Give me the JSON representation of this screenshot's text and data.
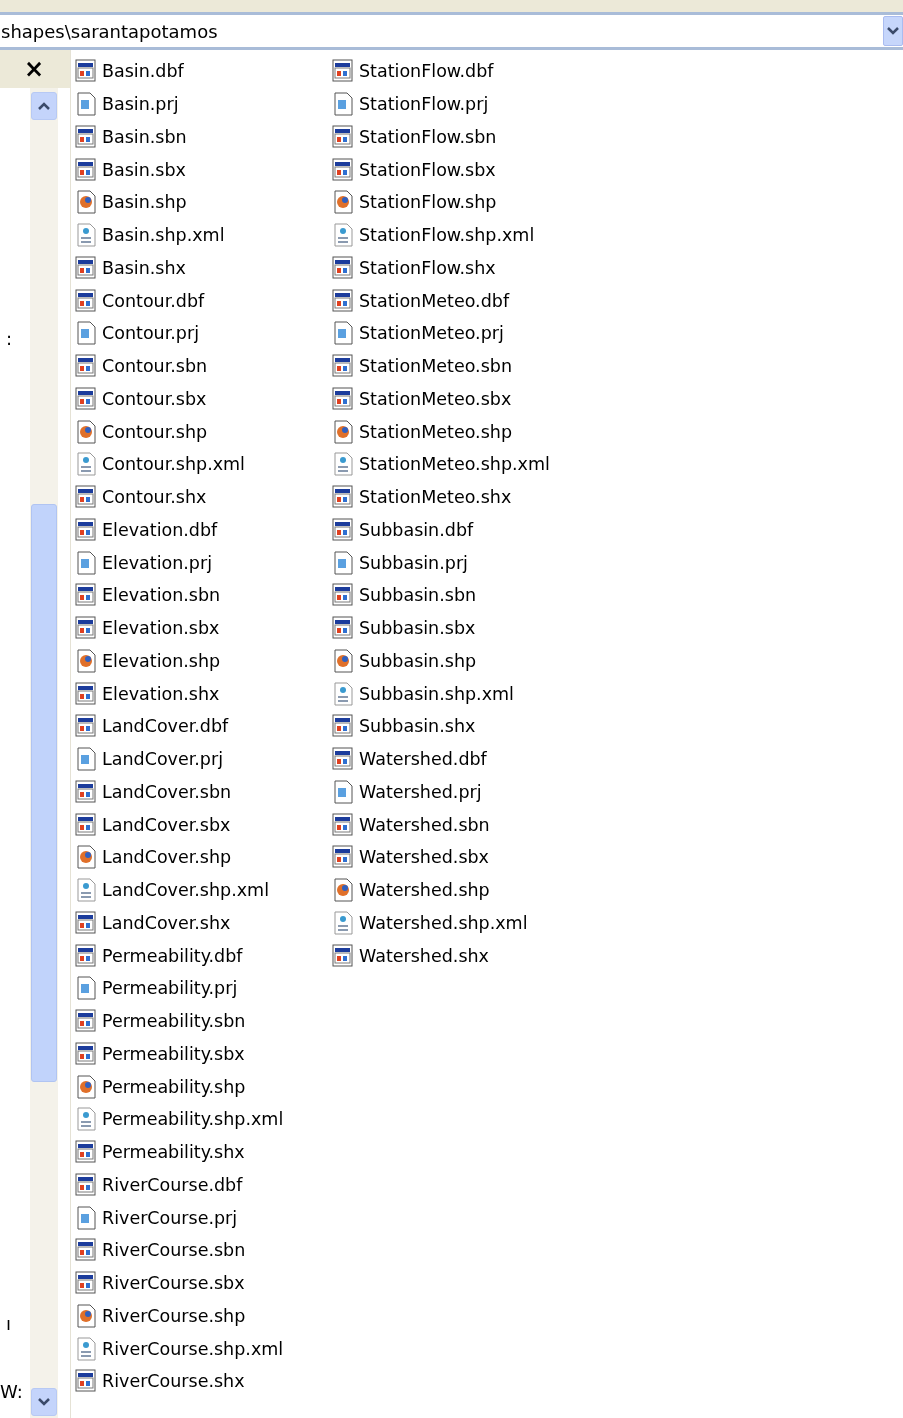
{
  "address_bar": {
    "path": "shapes\\sarantapotamos"
  },
  "left_pane": {
    "close": "×",
    "fragments": [
      ":",
      "ı",
      "W:"
    ]
  },
  "files": [
    {
      "name": "Basin.dbf",
      "kind": "table"
    },
    {
      "name": "Basin.prj",
      "kind": "projection"
    },
    {
      "name": "Basin.sbn",
      "kind": "table"
    },
    {
      "name": "Basin.sbx",
      "kind": "table"
    },
    {
      "name": "Basin.shp",
      "kind": "shape"
    },
    {
      "name": "Basin.shp.xml",
      "kind": "xml"
    },
    {
      "name": "Basin.shx",
      "kind": "table"
    },
    {
      "name": "Contour.dbf",
      "kind": "table"
    },
    {
      "name": "Contour.prj",
      "kind": "projection"
    },
    {
      "name": "Contour.sbn",
      "kind": "table"
    },
    {
      "name": "Contour.sbx",
      "kind": "table"
    },
    {
      "name": "Contour.shp",
      "kind": "shape"
    },
    {
      "name": "Contour.shp.xml",
      "kind": "xml"
    },
    {
      "name": "Contour.shx",
      "kind": "table"
    },
    {
      "name": "Elevation.dbf",
      "kind": "table"
    },
    {
      "name": "Elevation.prj",
      "kind": "projection"
    },
    {
      "name": "Elevation.sbn",
      "kind": "table"
    },
    {
      "name": "Elevation.sbx",
      "kind": "table"
    },
    {
      "name": "Elevation.shp",
      "kind": "shape"
    },
    {
      "name": "Elevation.shx",
      "kind": "table"
    },
    {
      "name": "LandCover.dbf",
      "kind": "table"
    },
    {
      "name": "LandCover.prj",
      "kind": "projection"
    },
    {
      "name": "LandCover.sbn",
      "kind": "table"
    },
    {
      "name": "LandCover.sbx",
      "kind": "table"
    },
    {
      "name": "LandCover.shp",
      "kind": "shape"
    },
    {
      "name": "LandCover.shp.xml",
      "kind": "xml"
    },
    {
      "name": "LandCover.shx",
      "kind": "table"
    },
    {
      "name": "Permeability.dbf",
      "kind": "table"
    },
    {
      "name": "Permeability.prj",
      "kind": "projection"
    },
    {
      "name": "Permeability.sbn",
      "kind": "table"
    },
    {
      "name": "Permeability.sbx",
      "kind": "table"
    },
    {
      "name": "Permeability.shp",
      "kind": "shape"
    },
    {
      "name": "Permeability.shp.xml",
      "kind": "xml"
    },
    {
      "name": "Permeability.shx",
      "kind": "table"
    },
    {
      "name": "RiverCourse.dbf",
      "kind": "table"
    },
    {
      "name": "RiverCourse.prj",
      "kind": "projection"
    },
    {
      "name": "RiverCourse.sbn",
      "kind": "table"
    },
    {
      "name": "RiverCourse.sbx",
      "kind": "table"
    },
    {
      "name": "RiverCourse.shp",
      "kind": "shape"
    },
    {
      "name": "RiverCourse.shp.xml",
      "kind": "xml"
    },
    {
      "name": "RiverCourse.shx",
      "kind": "table"
    },
    {
      "name": "StationFlow.dbf",
      "kind": "table"
    },
    {
      "name": "StationFlow.prj",
      "kind": "projection"
    },
    {
      "name": "StationFlow.sbn",
      "kind": "table"
    },
    {
      "name": "StationFlow.sbx",
      "kind": "table"
    },
    {
      "name": "StationFlow.shp",
      "kind": "shape"
    },
    {
      "name": "StationFlow.shp.xml",
      "kind": "xml"
    },
    {
      "name": "StationFlow.shx",
      "kind": "table"
    },
    {
      "name": "StationMeteo.dbf",
      "kind": "table"
    },
    {
      "name": "StationMeteo.prj",
      "kind": "projection"
    },
    {
      "name": "StationMeteo.sbn",
      "kind": "table"
    },
    {
      "name": "StationMeteo.sbx",
      "kind": "table"
    },
    {
      "name": "StationMeteo.shp",
      "kind": "shape"
    },
    {
      "name": "StationMeteo.shp.xml",
      "kind": "xml"
    },
    {
      "name": "StationMeteo.shx",
      "kind": "table"
    },
    {
      "name": "Subbasin.dbf",
      "kind": "table"
    },
    {
      "name": "Subbasin.prj",
      "kind": "projection"
    },
    {
      "name": "Subbasin.sbn",
      "kind": "table"
    },
    {
      "name": "Subbasin.sbx",
      "kind": "table"
    },
    {
      "name": "Subbasin.shp",
      "kind": "shape"
    },
    {
      "name": "Subbasin.shp.xml",
      "kind": "xml"
    },
    {
      "name": "Subbasin.shx",
      "kind": "table"
    },
    {
      "name": "Watershed.dbf",
      "kind": "table"
    },
    {
      "name": "Watershed.prj",
      "kind": "projection"
    },
    {
      "name": "Watershed.sbn",
      "kind": "table"
    },
    {
      "name": "Watershed.sbx",
      "kind": "table"
    },
    {
      "name": "Watershed.shp",
      "kind": "shape"
    },
    {
      "name": "Watershed.shp.xml",
      "kind": "xml"
    },
    {
      "name": "Watershed.shx",
      "kind": "table"
    }
  ]
}
